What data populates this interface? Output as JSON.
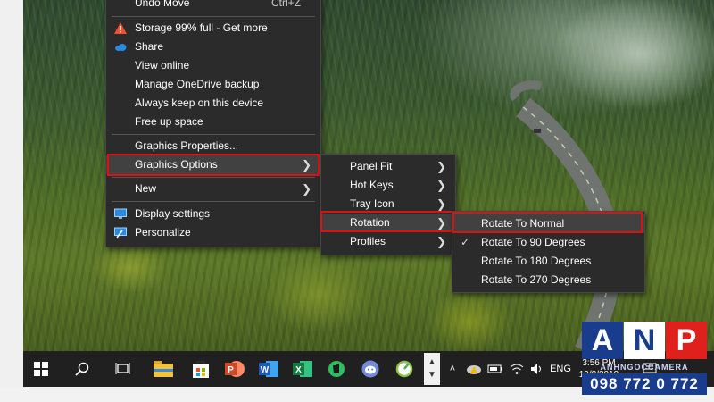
{
  "main_menu": {
    "items": [
      {
        "label": "Undo Move",
        "shortcut": "Ctrl+Z"
      },
      {
        "label": "Storage 99% full - Get more",
        "icon": "warning-icon"
      },
      {
        "label": "Share",
        "icon": "onedrive-cloud-icon"
      },
      {
        "label": "View online"
      },
      {
        "label": "Manage OneDrive backup"
      },
      {
        "label": "Always keep on this device"
      },
      {
        "label": "Free up space"
      },
      {
        "label": "Graphics Properties..."
      },
      {
        "label": "Graphics Options",
        "submenu": true,
        "highlighted": true
      },
      {
        "label": "New",
        "submenu": true
      },
      {
        "label": "Display settings",
        "icon": "display-settings-icon"
      },
      {
        "label": "Personalize",
        "icon": "personalize-icon"
      }
    ]
  },
  "graphics_submenu": {
    "items": [
      {
        "label": "Panel Fit",
        "submenu": true
      },
      {
        "label": "Hot Keys",
        "submenu": true
      },
      {
        "label": "Tray Icon",
        "submenu": true
      },
      {
        "label": "Rotation",
        "submenu": true,
        "highlighted": true
      },
      {
        "label": "Profiles",
        "submenu": true
      }
    ]
  },
  "rotation_submenu": {
    "items": [
      {
        "label": "Rotate To Normal",
        "highlighted": true
      },
      {
        "label": "Rotate To 90 Degrees",
        "checked": true
      },
      {
        "label": "Rotate To 180 Degrees"
      },
      {
        "label": "Rotate To 270 Degrees"
      }
    ]
  },
  "taskbar": {
    "apps": [
      "windows-start-icon",
      "search-icon",
      "task-view-icon",
      "file-explorer-icon",
      "store-icon",
      "powerpoint-icon",
      "word-icon",
      "excel-icon",
      "evernote-icon",
      "discord-icon",
      "app-icon"
    ],
    "tray": {
      "language": "ENG",
      "time": "3:56 PM",
      "date": "10/8/2019"
    }
  },
  "watermark": {
    "letters": [
      "A",
      "N",
      "P"
    ],
    "subtitle": "ANHNGOCCAMERA",
    "phone": "098 772 0 772"
  },
  "colors": {
    "menu_bg": "#2b2b2b",
    "highlight": "#414141",
    "red_outline": "#dd1111",
    "taskbar": "#202020",
    "anp_blue": "#1a3c8c",
    "anp_red": "#e0201c"
  }
}
